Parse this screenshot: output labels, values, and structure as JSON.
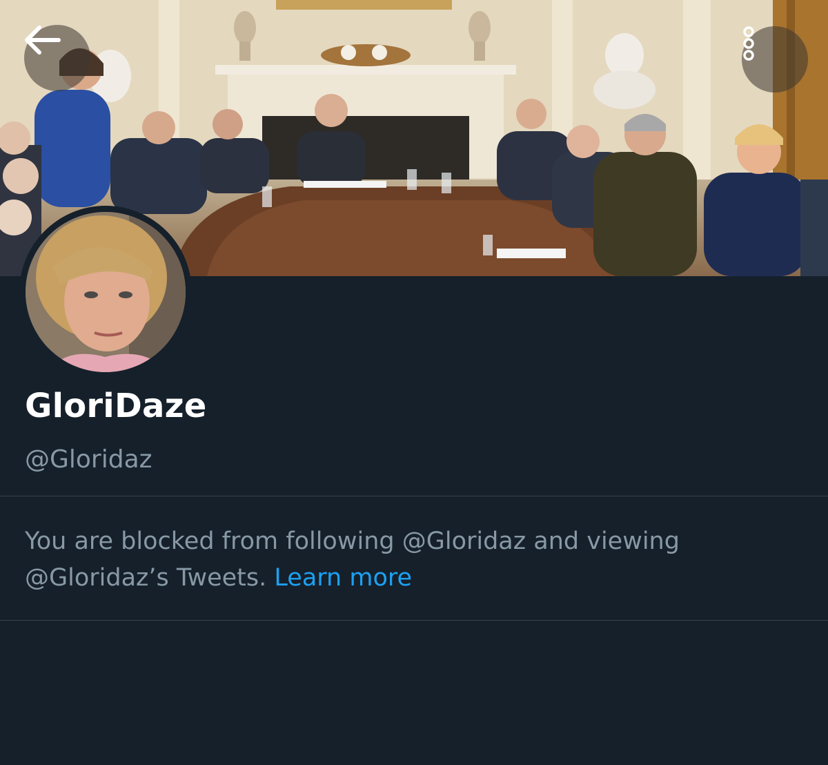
{
  "header": {
    "back_icon": "arrow-left-icon",
    "more_icon": "more-vertical-icon"
  },
  "profile": {
    "display_name": "GloriDaze",
    "handle": "@Gloridaz"
  },
  "blocked_notice": {
    "text": "You are blocked from following @Gloridaz and viewing @Gloridaz’s Tweets.",
    "link_label": "Learn more"
  },
  "colors": {
    "background": "#15202b",
    "divider": "#38444d",
    "secondary_text": "#8899a6",
    "link": "#1da1f2"
  }
}
